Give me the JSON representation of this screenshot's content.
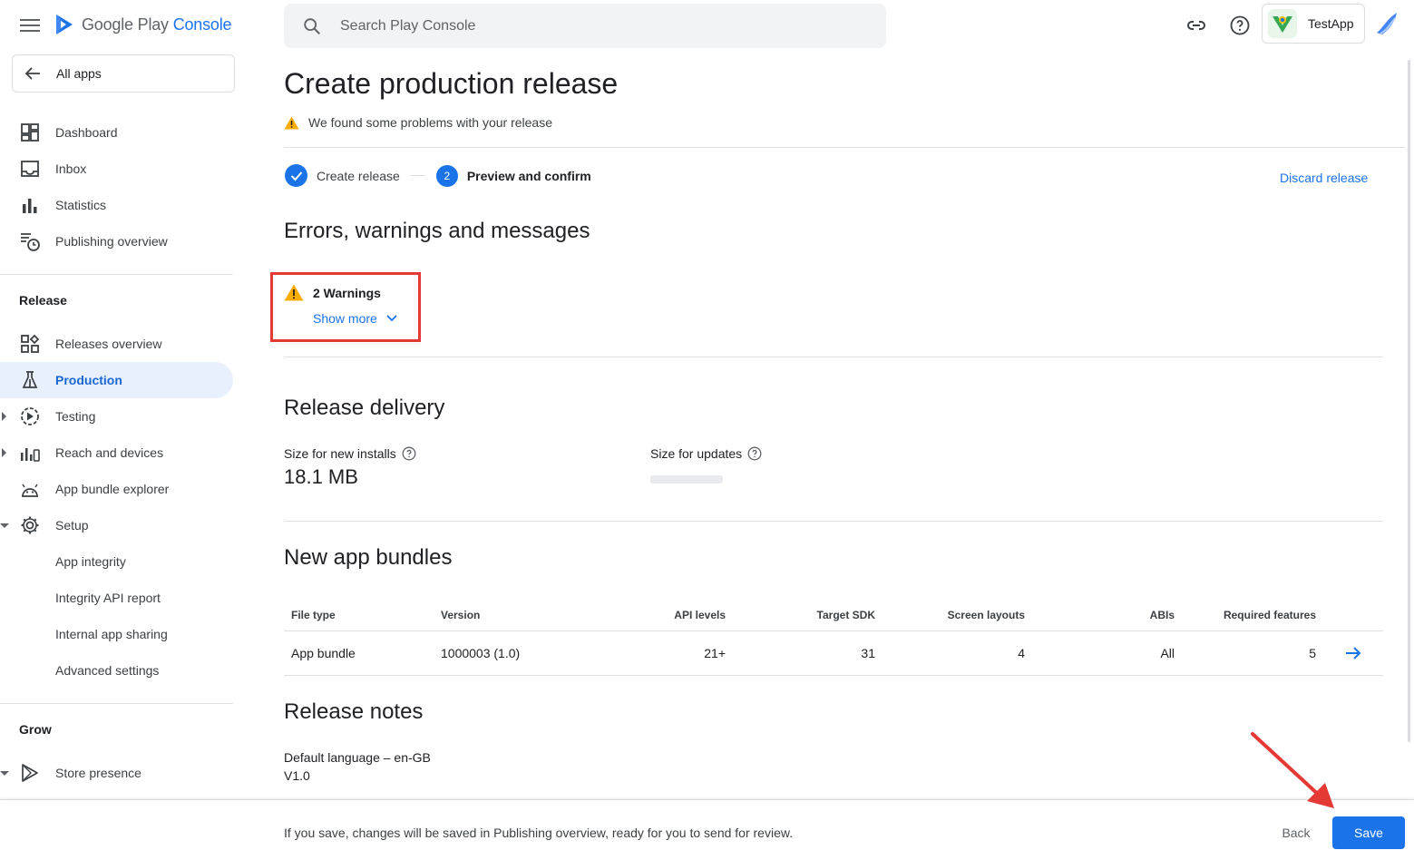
{
  "header": {
    "logo_text_main": "Google Play",
    "logo_text_accent": "Console",
    "search_placeholder": "Search Play Console",
    "app_name": "TestApp"
  },
  "sidebar": {
    "all_apps": "All apps",
    "top_items": [
      {
        "label": "Dashboard",
        "icon": "dashboard-icon"
      },
      {
        "label": "Inbox",
        "icon": "inbox-icon"
      },
      {
        "label": "Statistics",
        "icon": "bar-chart-icon"
      },
      {
        "label": "Publishing overview",
        "icon": "publishing-clock-icon"
      }
    ],
    "release_section": "Release",
    "release_items": [
      {
        "label": "Releases overview",
        "icon": "grid-icon"
      },
      {
        "label": "Production",
        "icon": "flask-icon",
        "active": true
      },
      {
        "label": "Testing",
        "icon": "play-circle-icon"
      },
      {
        "label": "Reach and devices",
        "icon": "bar-chart-device-icon"
      },
      {
        "label": "App bundle explorer",
        "icon": "android-icon"
      },
      {
        "label": "Setup",
        "icon": "gear-icon"
      },
      {
        "label": "App integrity"
      },
      {
        "label": "Integrity API report"
      },
      {
        "label": "Internal app sharing"
      },
      {
        "label": "Advanced settings"
      }
    ],
    "grow_section": "Grow",
    "grow_items": [
      {
        "label": "Store presence",
        "icon": "play-outline-icon"
      }
    ]
  },
  "main": {
    "title": "Create production release",
    "problem_text": "We found some problems with your release",
    "steps": [
      {
        "label": "Create release",
        "state": "done"
      },
      {
        "label": "Preview and confirm",
        "state": "current",
        "number": "2"
      }
    ],
    "discard": "Discard release",
    "errors_heading": "Errors, warnings and messages",
    "warnings_count": "2 Warnings",
    "show_more": "Show more",
    "delivery_heading": "Release delivery",
    "size_new_label": "Size for new installs",
    "size_new_value": "18.1 MB",
    "size_updates_label": "Size for updates",
    "bundles_heading": "New app bundles",
    "table": {
      "headers": [
        "File type",
        "Version",
        "API levels",
        "Target SDK",
        "Screen layouts",
        "ABIs",
        "Required features"
      ],
      "rows": [
        [
          "App bundle",
          "1000003 (1.0)",
          "21+",
          "31",
          "4",
          "All",
          "5"
        ]
      ]
    },
    "notes_heading": "Release notes",
    "notes_language": "Default language – en-GB",
    "notes_text": "V1.0"
  },
  "footer": {
    "text": "If you save, changes will be saved in Publishing overview, ready for you to send for review.",
    "back": "Back",
    "save": "Save"
  },
  "colors": {
    "accent": "#1a73e8",
    "warning": "#f9ab00",
    "highlight": "#e53935"
  }
}
